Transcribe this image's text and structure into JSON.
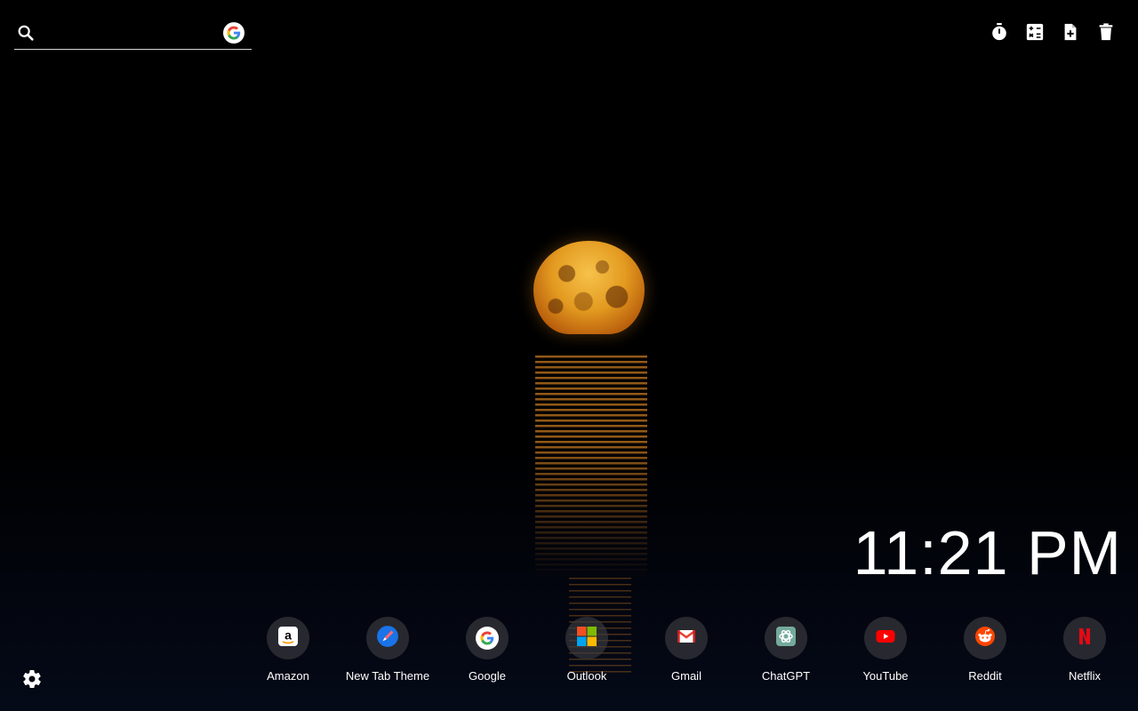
{
  "search": {
    "placeholder": "",
    "value": "",
    "search_icon": "search-icon",
    "engine_icon": "google-icon"
  },
  "toolbar": {
    "items": [
      {
        "icon": "stopwatch-icon"
      },
      {
        "icon": "calculator-icon"
      },
      {
        "icon": "add-note-icon"
      },
      {
        "icon": "trash-icon"
      }
    ]
  },
  "clock": {
    "time": "11:21 PM"
  },
  "shortcuts": [
    {
      "label": "Amazon",
      "icon": "amazon-icon"
    },
    {
      "label": "New Tab Theme",
      "icon": "new-tab-theme-icon"
    },
    {
      "label": "Google",
      "icon": "google-icon"
    },
    {
      "label": "Outlook",
      "icon": "microsoft-icon"
    },
    {
      "label": "Gmail",
      "icon": "gmail-icon"
    },
    {
      "label": "ChatGPT",
      "icon": "chatgpt-icon"
    },
    {
      "label": "YouTube",
      "icon": "youtube-icon"
    },
    {
      "label": "Reddit",
      "icon": "reddit-icon"
    },
    {
      "label": "Netflix",
      "icon": "netflix-icon"
    }
  ],
  "settings": {
    "icon": "gear-icon"
  },
  "colors": {
    "moon": "#e39a20",
    "youtube_red": "#ff0000",
    "netflix_red": "#e50914",
    "reddit_orange": "#ff4500"
  }
}
